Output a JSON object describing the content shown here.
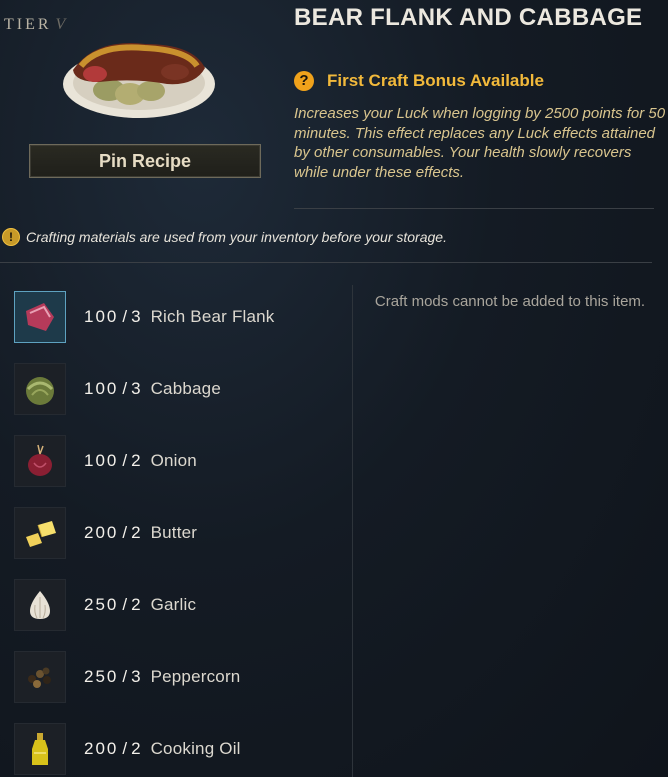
{
  "header": {
    "tier_label": "TIER",
    "tier_value": "V",
    "title": "BEAR FLANK AND CABBAGE",
    "pin_button_label": "Pin Recipe"
  },
  "bonus": {
    "icon_glyph": "?",
    "title": "First Craft Bonus Available",
    "description": "Increases your Luck when logging by 2500 points for 50 minutes. This effect replaces any Luck effects attained by other consumables. Your health slowly recovers while under these effects."
  },
  "notice": {
    "icon_glyph": "!",
    "text": "Crafting materials are used from your inventory before your storage."
  },
  "mods": {
    "text": "Craft mods cannot be added to this item."
  },
  "ingredients": [
    {
      "have": "100",
      "need": "3",
      "name": "Rich Bear Flank",
      "icon": "meat-icon",
      "selected": true
    },
    {
      "have": "100",
      "need": "3",
      "name": "Cabbage",
      "icon": "cabbage-icon",
      "selected": false
    },
    {
      "have": "100",
      "need": "2",
      "name": "Onion",
      "icon": "onion-icon",
      "selected": false
    },
    {
      "have": "200",
      "need": "2",
      "name": "Butter",
      "icon": "butter-icon",
      "selected": false
    },
    {
      "have": "250",
      "need": "2",
      "name": "Garlic",
      "icon": "garlic-icon",
      "selected": false
    },
    {
      "have": "250",
      "need": "3",
      "name": "Peppercorn",
      "icon": "peppercorn-icon",
      "selected": false
    },
    {
      "have": "200",
      "need": "2",
      "name": "Cooking Oil",
      "icon": "oil-bottle-icon",
      "selected": false
    }
  ],
  "colors": {
    "bonus_title": "#f2b93b",
    "bonus_text": "#d9c58e",
    "selected_border": "#5ea2c0"
  }
}
